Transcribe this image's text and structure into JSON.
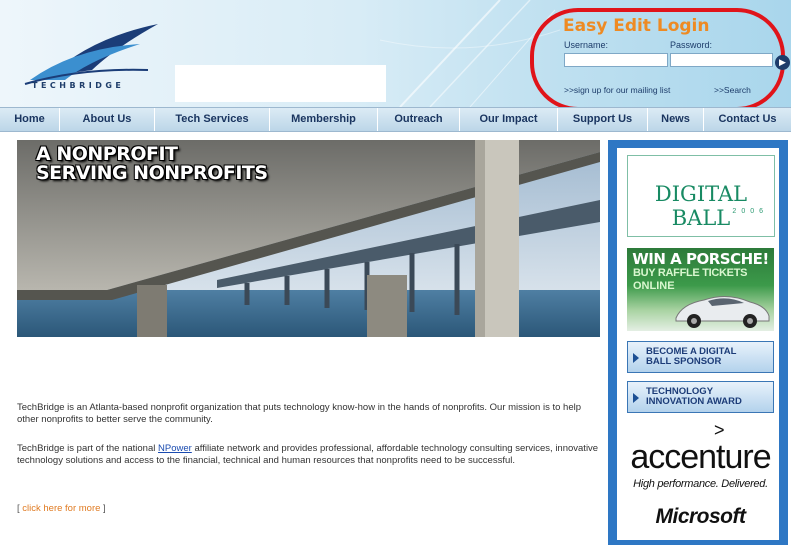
{
  "header": {
    "logo_text": "TECHBRIDGE"
  },
  "login": {
    "title": "Easy Edit Login",
    "username_label": "Username:",
    "password_label": "Password:",
    "go_icon": "arrow-right-icon",
    "mailing_list_link": ">>sign up for our mailing list",
    "search_link": ">>Search"
  },
  "nav": {
    "items": [
      {
        "label": "Home"
      },
      {
        "label": "About Us"
      },
      {
        "label": "Tech Services"
      },
      {
        "label": "Membership"
      },
      {
        "label": "Outreach"
      },
      {
        "label": "Our Impact"
      },
      {
        "label": "Support Us"
      },
      {
        "label": "News"
      },
      {
        "label": "Contact Us"
      }
    ]
  },
  "hero": {
    "line1": "A NONPROFIT",
    "line2": "SERVING NONPROFITS"
  },
  "content": {
    "para1": "TechBridge is an Atlanta-based nonprofit organization that puts technology know-how in the hands of nonprofits. Our mission is to help other nonprofits to better serve the community.",
    "para2_before": "TechBridge is part of the national ",
    "para2_link": "NPower",
    "para2_after": " affiliate network and provides professional, affordable technology consulting services, innovative technology solutions and access to the financial, technical and human resources that nonprofits need to be successful.",
    "more_open": "[ ",
    "more_link": "click here for more",
    "more_close": " ]"
  },
  "sidebar": {
    "digital_ball_title": "DIGITAL BALL",
    "digital_ball_year": "2006",
    "porsche_line1": "WIN A PORSCHE!",
    "porsche_line2": "BUY RAFFLE TICKETS",
    "porsche_line3": "ONLINE",
    "sponsor_line1": "BECOME A DIGITAL",
    "sponsor_line2": "BALL SPONSOR",
    "award_line1": "TECHNOLOGY",
    "award_line2": "INNOVATION AWARD",
    "accenture_logo": "accenture",
    "accenture_tagline": "High performance. Delivered.",
    "microsoft_logo": "Microsoft"
  },
  "colors": {
    "login_title": "#ee8a22",
    "login_outline": "#e0141a",
    "nav_text": "#1a3560",
    "sidebar_bg": "#2e77c4",
    "link": "#1a4bb0",
    "more_link": "#e07b22"
  }
}
